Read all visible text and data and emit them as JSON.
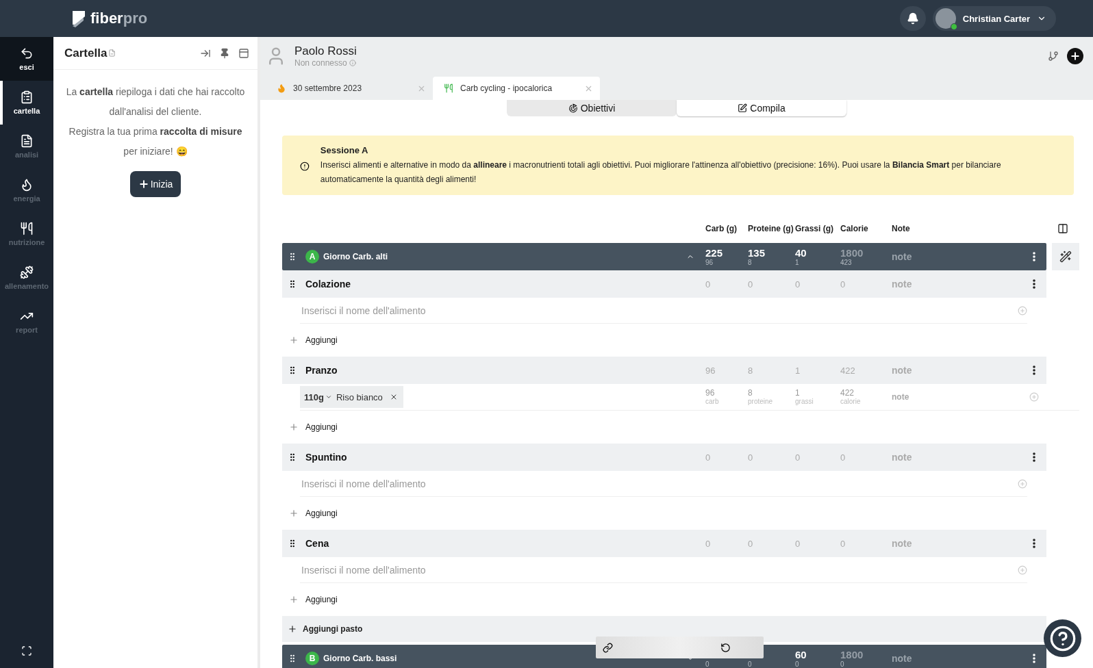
{
  "topbar": {
    "logo_main": "fiber",
    "logo_accent": "pro",
    "user": {
      "name": "Christian Carter",
      "online": true
    }
  },
  "nav": {
    "items": [
      {
        "kind": "exit",
        "label": "esci",
        "selected": false
      },
      {
        "kind": "folder",
        "label": "cartella",
        "selected": true
      },
      {
        "kind": "analysis",
        "label": "analisi",
        "selected": false
      },
      {
        "kind": "energy",
        "label": "energia",
        "selected": false
      },
      {
        "kind": "nutrition",
        "label": "nutrizione",
        "selected": false
      },
      {
        "kind": "training",
        "label": "allenamento",
        "selected": false
      },
      {
        "kind": "report",
        "label": "report",
        "selected": false
      }
    ]
  },
  "panel": {
    "title": "Cartella",
    "paragraphs": [
      "La **cartella** riepiloga i dati che hai raccolto dall'analisi del cliente.",
      "Registra la tua prima **raccolta di misure** per iniziare! 😄"
    ],
    "button": "Inizia"
  },
  "client": {
    "name": "Paolo Rossi",
    "status": "Non connesso"
  },
  "tabs": [
    {
      "kind": "energy",
      "label": "30 settembre 2023",
      "selected": false
    },
    {
      "kind": "nutrition",
      "label": "Carb cycling - ipocalorica",
      "selected": true
    }
  ],
  "segments": [
    {
      "kind": "goals",
      "label": "Obiettivi",
      "selected": false
    },
    {
      "kind": "edit",
      "label": "Compila",
      "selected": true
    }
  ],
  "alert": {
    "title": "Sessione A",
    "text": "Inserisci alimenti e alternative in modo da **allineare** i macronutrienti totali agli obiettivi. Puoi migliorare l'attinenza all'obiettivo (precisione: 16%). Puoi usare la **Bilancia Smart** per bilanciare automaticamente la quantità degli alimenti!"
  },
  "columns": [
    "Carb (g)",
    "Proteine (g)",
    "Grassi (g)",
    "Calorie",
    "Note"
  ],
  "days": [
    {
      "badge": "A",
      "name": "Giorno Carb. alti",
      "expanded": true,
      "note": "note",
      "macros": [
        {
          "value": "225",
          "sub": "96",
          "muted": false
        },
        {
          "value": "135",
          "sub": "8",
          "muted": false
        },
        {
          "value": "40",
          "sub": "1",
          "muted": false
        },
        {
          "value": "1800",
          "sub": "423",
          "muted": true
        }
      ],
      "meals": [
        {
          "name": "Colazione",
          "totals": [
            "0",
            "0",
            "0",
            "0"
          ],
          "note": "note",
          "placeholder": "Inserisci il nome dell'alimento",
          "add": "Aggiungi"
        },
        {
          "name": "Pranzo",
          "totals": [
            "96",
            "8",
            "1",
            "422"
          ],
          "note": "note",
          "add": "Aggiungi",
          "foods": [
            {
              "amount": "110g",
              "name": "Riso bianco",
              "note": "note",
              "values": [
                {
                  "value": "96",
                  "unit": "carb"
                },
                {
                  "value": "8",
                  "unit": "proteine"
                },
                {
                  "value": "1",
                  "unit": "grassi"
                },
                {
                  "value": "422",
                  "unit": "calorie"
                }
              ]
            }
          ]
        },
        {
          "name": "Spuntino",
          "totals": [
            "0",
            "0",
            "0",
            "0"
          ],
          "note": "note",
          "placeholder": "Inserisci il nome dell'alimento",
          "add": "Aggiungi"
        },
        {
          "name": "Cena",
          "totals": [
            "0",
            "0",
            "0",
            "0"
          ],
          "note": "note",
          "placeholder": "Inserisci il nome dell'alimento",
          "add": "Aggiungi"
        }
      ],
      "add_meal": "Aggiungi pasto"
    },
    {
      "badge": "B",
      "name": "Giorno Carb. bassi",
      "expanded": false,
      "note": "note",
      "macros": [
        {
          "sub": "0"
        },
        {
          "sub": "0"
        },
        {
          "value": "60",
          "sub": "0",
          "muted": false
        },
        {
          "value": "1800",
          "sub": "0",
          "muted": true
        }
      ]
    }
  ]
}
